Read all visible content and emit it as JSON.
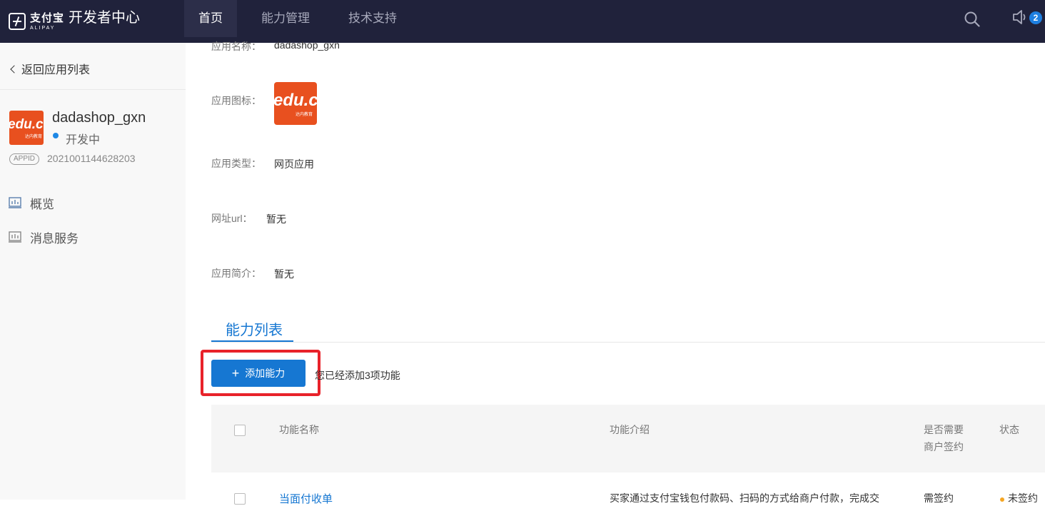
{
  "header": {
    "logo_cn": "支付宝",
    "logo_en": "ALIPAY",
    "brand": "开发者中心",
    "tabs": [
      {
        "label": "首页"
      },
      {
        "label": "能力管理"
      },
      {
        "label": "技术支持"
      }
    ],
    "notification_count": "2"
  },
  "sidebar": {
    "back_label": "返回应用列表",
    "app_name": "dadashop_gxn",
    "status": "开发中",
    "appid_tag": "APPID",
    "appid": "2021001144628203",
    "items": [
      {
        "label": "概览",
        "icon": "dashboard-icon"
      },
      {
        "label": "消息服务",
        "icon": "message-service-icon"
      }
    ]
  },
  "app_info": {
    "name_label": "应用名称：",
    "name_value": "dadashop_gxn",
    "icon_label": "应用图标：",
    "type_label": "应用类型：",
    "type_value": "网页应用",
    "url_label": "网址url：",
    "url_value": "暂无",
    "desc_label": "应用简介：",
    "desc_value": "暂无"
  },
  "logo_text": {
    "main": "edu.c",
    "sub": "达内教育"
  },
  "abilities": {
    "tab_title": "能力列表",
    "add_button": "添加能力",
    "added_count": "您已经添加3项功能",
    "columns": {
      "name": "功能名称",
      "intro": "功能介绍",
      "need_sign_line1": "是否需要",
      "need_sign_line2": "商户签约",
      "status": "状态"
    },
    "rows": [
      {
        "name": "当面付收单",
        "intro": "买家通过支付宝钱包付款码、扫码的方式给商户付款，完成交",
        "need_sign": "需签约",
        "status": "未签约"
      }
    ]
  },
  "colors": {
    "nav_bg": "#20223b",
    "primary": "#1677d2",
    "highlight": "#e8222a",
    "logo_orange": "#e8501f"
  }
}
